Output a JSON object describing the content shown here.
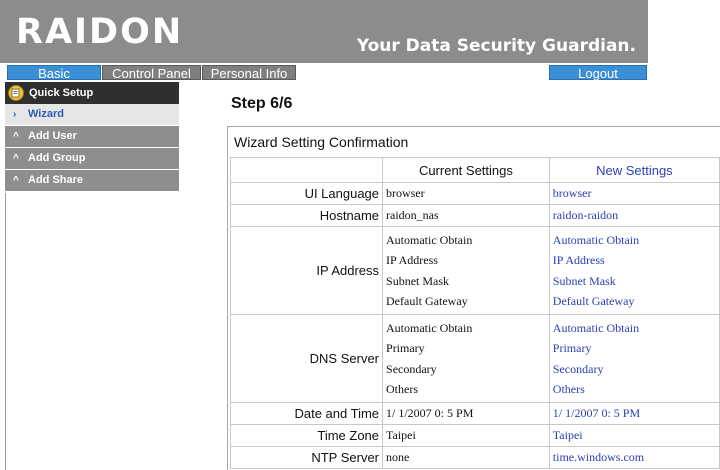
{
  "header": {
    "logo": "RAIDON",
    "tagline": "Your Data Security Guardian."
  },
  "tabs": {
    "basic": "Basic",
    "control_panel": "Control Panel",
    "personal_info": "Personal Info",
    "logout": "Logout"
  },
  "sidebar": {
    "section": "Quick Setup",
    "items": [
      {
        "label": "Wizard",
        "marker": "›",
        "active": true
      },
      {
        "label": "Add User",
        "marker": "^",
        "active": false
      },
      {
        "label": "Add Group",
        "marker": "^",
        "active": false
      },
      {
        "label": "Add Share",
        "marker": "^",
        "active": false
      }
    ]
  },
  "main": {
    "step": "Step 6/6",
    "panel_title": "Wizard Setting Confirmation",
    "col_current": "Current Settings",
    "col_new": "New Settings",
    "rows": [
      {
        "label": "UI Language",
        "current": [
          "browser"
        ],
        "new": [
          "browser"
        ]
      },
      {
        "label": "Hostname",
        "current": [
          "raidon_nas"
        ],
        "new": [
          "raidon-raidon"
        ]
      },
      {
        "label": "IP Address",
        "current": [
          "Automatic Obtain",
          "IP Address",
          "Subnet Mask",
          "Default Gateway"
        ],
        "new": [
          "Automatic Obtain",
          "IP Address",
          "Subnet Mask",
          "Default Gateway"
        ]
      },
      {
        "label": "DNS Server",
        "current": [
          "Automatic Obtain",
          "Primary",
          "Secondary",
          "Others"
        ],
        "new": [
          "Automatic Obtain",
          "Primary",
          "Secondary",
          "Others"
        ]
      },
      {
        "label": "Date and Time",
        "current": [
          "1/ 1/2007 0: 5 PM"
        ],
        "new": [
          "1/ 1/2007 0: 5 PM"
        ]
      },
      {
        "label": "Time Zone",
        "current": [
          "Taipei"
        ],
        "new": [
          "Taipei"
        ]
      },
      {
        "label": "NTP Server",
        "current": [
          "none"
        ],
        "new": [
          "time.windows.com"
        ]
      }
    ]
  }
}
